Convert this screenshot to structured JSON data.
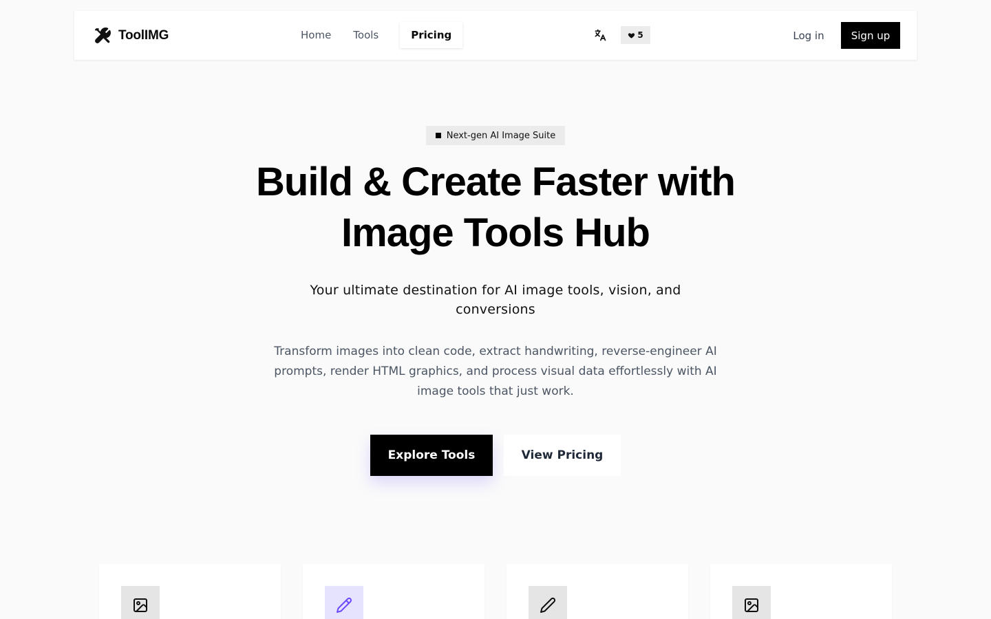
{
  "brand": {
    "name": "ToolIMG",
    "icon": "tools-icon"
  },
  "nav": {
    "links": [
      {
        "label": "Home"
      },
      {
        "label": "Tools"
      },
      {
        "label": "Pricing",
        "active": true
      }
    ],
    "language_icon": "translate-icon",
    "credits": {
      "icon": "heart-icon",
      "count": "5"
    },
    "login_label": "Log in",
    "signup_label": "Sign up"
  },
  "hero": {
    "badge": "Next-gen AI Image Suite",
    "title_line1": "Build & Create Faster with",
    "title_line2": "Image Tools Hub",
    "subtitle": "Your ultimate destination for AI image tools, vision, and conversions",
    "description": "Transform images into clean code, extract handwriting, reverse-engineer AI prompts, render HTML graphics, and process visual data effortlessly with AI image tools that just work.",
    "primary_cta": "Explore Tools",
    "secondary_cta": "View Pricing"
  },
  "cards": [
    {
      "icon": "image-icon"
    },
    {
      "icon": "pencil-icon",
      "accent": "#6d4aff"
    },
    {
      "icon": "pencil-icon"
    },
    {
      "icon": "image-icon"
    }
  ],
  "colors": {
    "background": "#fafafa",
    "primary": "#000000",
    "accent": "#6d4aff"
  }
}
